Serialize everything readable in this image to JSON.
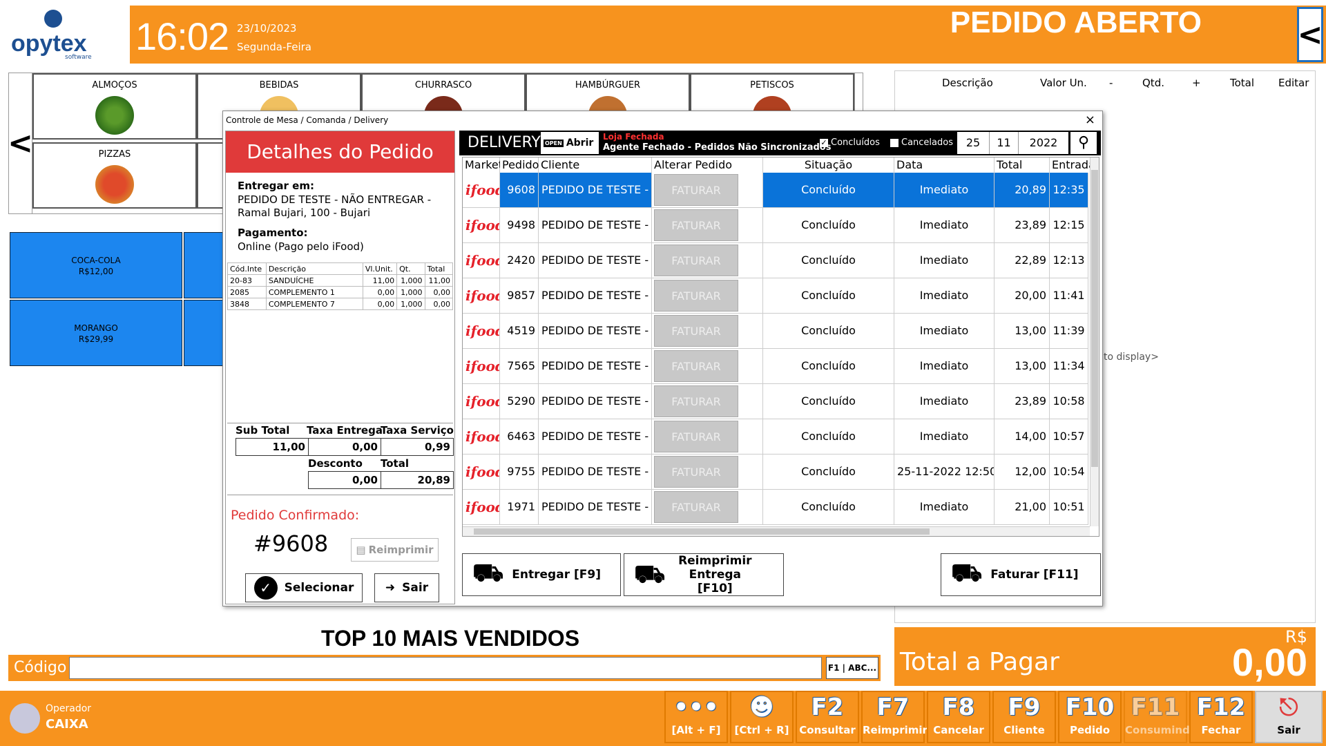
{
  "brand": {
    "name": "opytex",
    "tagline": "software"
  },
  "header": {
    "time": "16:02",
    "date": "23/10/2023",
    "weekday": "Segunda-Feira",
    "title": "PEDIDO ABERTO",
    "back_icon": "chevron-left-icon"
  },
  "categories": [
    {
      "label": "ALMOÇOS"
    },
    {
      "label": "BEBIDAS"
    },
    {
      "label": "CHURRASCO"
    },
    {
      "label": "HAMBÚRGUER"
    },
    {
      "label": "PETISCOS"
    },
    {
      "label": "PIZZAS"
    }
  ],
  "products": [
    {
      "name": "COCA-COLA",
      "price": "R$12,00"
    },
    {
      "name": "MORANGO",
      "price": "R$29,99"
    }
  ],
  "order_panel": {
    "columns": [
      "Descrição",
      "Valor Un.",
      "-",
      "Qtd.",
      "+",
      "Total",
      "Editar"
    ],
    "empty_text": "to display>"
  },
  "top10_label": "TOP 10 MAIS VENDIDOS",
  "code_bar": {
    "label": "Código",
    "value": "",
    "search_button": "F1 | ABC..."
  },
  "total": {
    "currency": "R$",
    "label": "Total a Pagar",
    "value": "0,00"
  },
  "operator": {
    "role": "Operador",
    "name": "CAIXA"
  },
  "function_keys": [
    {
      "key": "•••",
      "label": "[Alt + F]"
    },
    {
      "key": "",
      "label": "[Ctrl + R]"
    },
    {
      "key": "F2",
      "label": "Consultar"
    },
    {
      "key": "F7",
      "label": "Reimprimir"
    },
    {
      "key": "F8",
      "label": "Cancelar"
    },
    {
      "key": "F9",
      "label": "Cliente"
    },
    {
      "key": "F10",
      "label": "Pedido"
    },
    {
      "key": "F11",
      "label": "Consumindo"
    },
    {
      "key": "F12",
      "label": "Fechar"
    },
    {
      "key": "",
      "label": "Sair"
    }
  ],
  "dialog": {
    "breadcrumb": "Controle de Mesa / Comanda / Delivery",
    "close": "×",
    "details": {
      "title": "Detalhes do Pedido",
      "deliver_label": "Entregar em:",
      "deliver_value": "PEDIDO DE TESTE - NÃO ENTREGAR - Ramal Bujari, 100 - Bujari",
      "payment_label": "Pagamento:",
      "payment_value": "Online (Pago pelo iFood)",
      "items_header": [
        "Cód.Inte",
        "Descrição",
        "Vl.Unit.",
        "Qt.",
        "Total"
      ],
      "items": [
        [
          "20-83",
          "SANDUÍCHE",
          "11,00",
          "1,000",
          "11,00"
        ],
        [
          "2085",
          "COMPLEMENTO 1",
          "0,00",
          "1,000",
          "0,00"
        ],
        [
          "3848",
          "COMPLEMENTO 7",
          "0,00",
          "1,000",
          "0,00"
        ]
      ],
      "subtotal_label": "Sub Total",
      "subtotal": "11,00",
      "taxa_entrega_label": "Taxa Entrega",
      "taxa_entrega": "0,00",
      "taxa_servico_label": "Taxa Serviço",
      "taxa_servico": "0,99",
      "desconto_label": "Desconto",
      "desconto": "0,00",
      "total_label": "Total",
      "total": "20,89",
      "status": "Pedido Confirmado:",
      "order_number": "#9608",
      "reprint": "Reimprimir",
      "select": "Selecionar",
      "exit": "Sair"
    },
    "delivery": {
      "title": "DELIVERY",
      "open_badge": "OPEN",
      "open_label": "Abrir",
      "store_status": "Loja Fechada",
      "agent_status": "Agente Fechado - Pedidos Não Sincronizados",
      "filter_concluidos": "Concluídos",
      "filter_cancelados": "Cancelados",
      "day": "25",
      "month": "11",
      "year": "2022",
      "columns": [
        "Market",
        "Pedido",
        "Cliente",
        "Alterar Pedido",
        "Situação",
        "Data Agendamento",
        "Total",
        "Entrada"
      ],
      "rows": [
        {
          "market": "ifood",
          "pedido": "9608",
          "cliente": "PEDIDO DE TESTE - J",
          "alterar": "FATURAR",
          "situacao": "Concluído",
          "agendamento": "Imediato",
          "total": "20,89",
          "entrada": "12:35"
        },
        {
          "market": "ifood",
          "pedido": "9498",
          "cliente": "PEDIDO DE TESTE - J",
          "alterar": "FATURAR",
          "situacao": "Concluído",
          "agendamento": "Imediato",
          "total": "23,89",
          "entrada": "12:15"
        },
        {
          "market": "ifood",
          "pedido": "2420",
          "cliente": "PEDIDO DE TESTE - J",
          "alterar": "FATURAR",
          "situacao": "Concluído",
          "agendamento": "Imediato",
          "total": "22,89",
          "entrada": "12:13"
        },
        {
          "market": "ifood",
          "pedido": "9857",
          "cliente": "PEDIDO DE TESTE - J",
          "alterar": "FATURAR",
          "situacao": "Concluído",
          "agendamento": "Imediato",
          "total": "20,00",
          "entrada": "11:41"
        },
        {
          "market": "ifood",
          "pedido": "4519",
          "cliente": "PEDIDO DE TESTE - J",
          "alterar": "FATURAR",
          "situacao": "Concluído",
          "agendamento": "Imediato",
          "total": "13,00",
          "entrada": "11:39"
        },
        {
          "market": "ifood",
          "pedido": "7565",
          "cliente": "PEDIDO DE TESTE - J",
          "alterar": "FATURAR",
          "situacao": "Concluído",
          "agendamento": "Imediato",
          "total": "13,00",
          "entrada": "11:34"
        },
        {
          "market": "ifood",
          "pedido": "5290",
          "cliente": "PEDIDO DE TESTE - J",
          "alterar": "FATURAR",
          "situacao": "Concluído",
          "agendamento": "Imediato",
          "total": "23,89",
          "entrada": "10:58"
        },
        {
          "market": "ifood",
          "pedido": "6463",
          "cliente": "PEDIDO DE TESTE - J",
          "alterar": "FATURAR",
          "situacao": "Concluído",
          "agendamento": "Imediato",
          "total": "14,00",
          "entrada": "10:57"
        },
        {
          "market": "ifood",
          "pedido": "9755",
          "cliente": "PEDIDO DE TESTE - J",
          "alterar": "FATURAR",
          "situacao": "Concluído",
          "agendamento": "25-11-2022 12:50",
          "total": "12,00",
          "entrada": "10:54"
        },
        {
          "market": "ifood",
          "pedido": "1971",
          "cliente": "PEDIDO DE TESTE - J",
          "alterar": "FATURAR",
          "situacao": "Concluído",
          "agendamento": "Imediato",
          "total": "21,00",
          "entrada": "10:51"
        }
      ],
      "btn_entregar": "Entregar [F9]",
      "btn_reimprimir": "Reimprimir Entrega [F10]",
      "btn_faturar": "Faturar [F11]"
    }
  },
  "colors": {
    "orange": "#F7931E",
    "blue": "#1c86ef",
    "red": "#e03a3a",
    "selected": "#0a73d9"
  }
}
